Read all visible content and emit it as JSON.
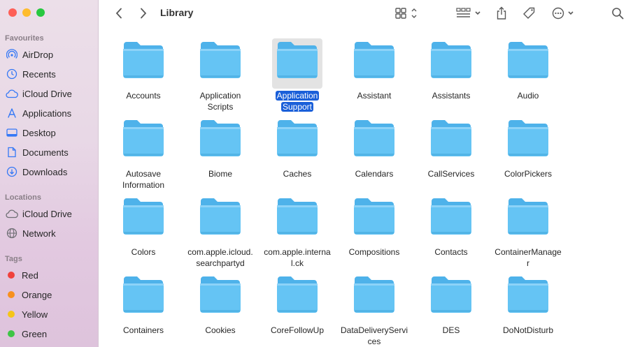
{
  "window": {
    "title": "Library"
  },
  "colors": {
    "accent": "#1a5fd9",
    "folder": "#65c4f4"
  },
  "sidebar": {
    "favourites_header": "Favourites",
    "favourites": [
      {
        "label": "AirDrop",
        "icon": "airdrop-icon"
      },
      {
        "label": "Recents",
        "icon": "clock-icon"
      },
      {
        "label": "iCloud Drive",
        "icon": "cloud-icon"
      },
      {
        "label": "Applications",
        "icon": "applications-icon"
      },
      {
        "label": "Desktop",
        "icon": "desktop-icon"
      },
      {
        "label": "Documents",
        "icon": "document-icon"
      },
      {
        "label": "Downloads",
        "icon": "download-icon"
      }
    ],
    "locations_header": "Locations",
    "locations": [
      {
        "label": "iCloud Drive",
        "icon": "cloud-icon"
      },
      {
        "label": "Network",
        "icon": "globe-icon"
      }
    ],
    "tags_header": "Tags",
    "tags": [
      {
        "label": "Red",
        "color": "#f0413c"
      },
      {
        "label": "Orange",
        "color": "#f7901e"
      },
      {
        "label": "Yellow",
        "color": "#f5c518"
      },
      {
        "label": "Green",
        "color": "#3ec545"
      }
    ]
  },
  "folders": [
    [
      "Accounts",
      "Application Scripts",
      "Application Support",
      "Assistant",
      "Assistants",
      "Audio"
    ],
    [
      "Autosave Information",
      "Biome",
      "Caches",
      "Calendars",
      "CallServices",
      "ColorPickers"
    ],
    [
      "Colors",
      "com.apple.icloud.searchpartyd",
      "com.apple.internal.ck",
      "Compositions",
      "Contacts",
      "ContainerManager"
    ],
    [
      "Containers",
      "Cookies",
      "CoreFollowUp",
      "DataDeliveryServices",
      "DES",
      "DoNotDisturb"
    ]
  ],
  "labels": {
    "r0": [
      "Accounts",
      [
        "Application",
        "Scripts"
      ],
      [
        "Application",
        "Support"
      ],
      "Assistant",
      "Assistants",
      "Audio"
    ],
    "r1": [
      [
        "Autosave",
        "Information"
      ],
      "Biome",
      "Caches",
      "Calendars",
      "CallServices",
      "ColorPickers"
    ],
    "r2": [
      "Colors",
      [
        "com.apple.icloud.",
        "searchpartyd"
      ],
      [
        "com.apple.interna",
        "l.ck"
      ],
      "Compositions",
      "Contacts",
      [
        "ContainerManage",
        "r"
      ]
    ],
    "r3": [
      "Containers",
      "Cookies",
      "CoreFollowUp",
      [
        "DataDeliveryServi",
        "ces"
      ],
      "DES",
      "DoNotDisturb"
    ]
  },
  "selected": "Application Support"
}
